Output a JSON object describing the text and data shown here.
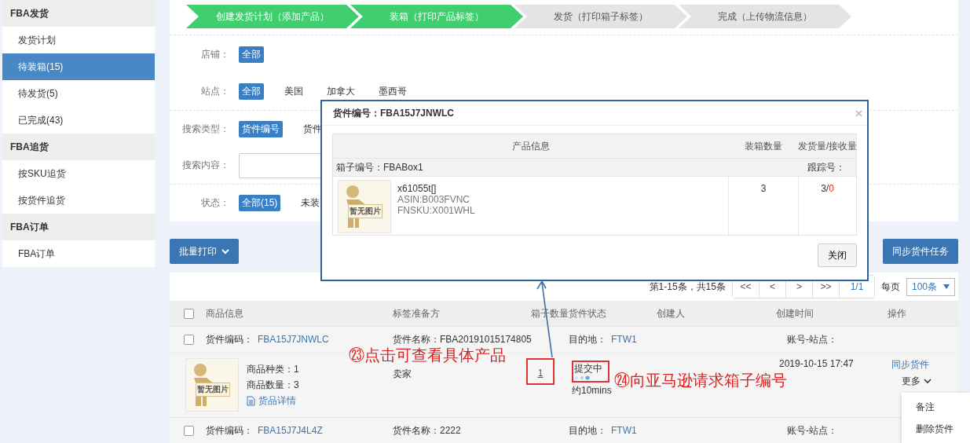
{
  "sidebar": {
    "groups": [
      {
        "title": "FBA发货",
        "items": [
          {
            "label": "发货计划",
            "selected": false
          },
          {
            "label": "待装箱(15)",
            "selected": true
          },
          {
            "label": "待发货(5)",
            "selected": false
          },
          {
            "label": "已完成(43)",
            "selected": false
          }
        ]
      },
      {
        "title": "FBA追货",
        "items": [
          {
            "label": "按SKU追货",
            "selected": false
          },
          {
            "label": "按货件追货",
            "selected": false
          }
        ]
      },
      {
        "title": "FBA订单",
        "items": [
          {
            "label": "FBA订单",
            "selected": false
          }
        ]
      }
    ]
  },
  "steps": [
    {
      "label": "创建发货计划（添加产品）",
      "done": true
    },
    {
      "label": "装箱（打印产品标签）",
      "done": true
    },
    {
      "label": "发货（打印箱子标签）",
      "done": false
    },
    {
      "label": "完成（上传物流信息）",
      "done": false
    }
  ],
  "filters": [
    {
      "label": "店铺：",
      "kind": "options",
      "divider_after": false,
      "options": [
        {
          "label": "全部",
          "selected": true
        }
      ]
    },
    {
      "label": "站点：",
      "kind": "options",
      "divider_after": true,
      "options": [
        {
          "label": "全部",
          "selected": true
        },
        {
          "label": "美国",
          "selected": false
        },
        {
          "label": "加拿大",
          "selected": false
        },
        {
          "label": "墨西哥",
          "selected": false
        }
      ]
    },
    {
      "label": "搜索类型：",
      "kind": "options",
      "divider_after": false,
      "options": [
        {
          "label": "货件编号",
          "selected": true
        },
        {
          "label": "货件",
          "selected": false
        }
      ]
    },
    {
      "label": "搜索内容：",
      "kind": "input",
      "divider_after": true
    },
    {
      "label": "状态：",
      "kind": "options",
      "divider_after": false,
      "options": [
        {
          "label": "全部(15)",
          "selected": true
        },
        {
          "label": "未装",
          "selected": false
        }
      ]
    }
  ],
  "toolbar": {
    "batch_print": "批量打印",
    "sync": "同步货件任务"
  },
  "pagination": {
    "summary": "第1-15条，共15条",
    "buttons": [
      "<<",
      "<",
      ">",
      ">>",
      "1/1"
    ],
    "per_page_label": "每页",
    "per_page": "100条"
  },
  "table": {
    "all_checked": false,
    "columns": [
      "商品信息",
      "标签准备方",
      "箱子数量",
      "货件状态",
      "创建人",
      "创建时间",
      "操作"
    ],
    "shipments": [
      {
        "checked": false,
        "code_label": "货件编码：",
        "code": "FBA15J7JNWLC",
        "name_label": "货件名称：",
        "name": "FBA20191015174805",
        "dest_label": "目的地：",
        "dest": "FTW1",
        "account_label": "账号-站点：",
        "detail": {
          "no_image": "暂无图片",
          "kinds": "商品种类：1",
          "qty": "商品数量：3",
          "details_link": "货品详情",
          "prep": "卖家",
          "box_count": {
            "text": "1",
            "highlighted": true
          },
          "status": {
            "text": "提交中",
            "highlighted": true,
            "loading": true
          },
          "eta": "约10mins",
          "created": "2019-10-15 17:47",
          "sync": "同步货件",
          "more": "更多",
          "menu_open": true,
          "menu": [
            "备注",
            "删除货件"
          ]
        }
      },
      {
        "checked": false,
        "code_label": "货件编码：",
        "code": "FBA15J7J4L4Z",
        "name_label": "货件名称：",
        "name": "2222",
        "dest_label": "目的地：",
        "dest": "FTW1",
        "account_label": "账号-站点："
      }
    ]
  },
  "modal": {
    "title": "货件编号：FBA15J7JNWLC",
    "columns": [
      "产品信息",
      "装箱数量",
      "发货量/接收量"
    ],
    "box_label": "箱子编号：FBABox1",
    "tracking_label": "跟踪号：",
    "items": [
      {
        "no_image": "暂无图片",
        "name": "x61055t[]",
        "asin": "ASIN:B003FVNC",
        "fnsku": "FNSKU:X001WHL",
        "packed": "3",
        "shipped": "3/",
        "received": "0"
      }
    ],
    "close_button": "关闭"
  },
  "annotations": [
    {
      "text": "㉓点击可查看具体产品"
    },
    {
      "text": "㉔向亚马逊请求箱子编号"
    }
  ]
}
